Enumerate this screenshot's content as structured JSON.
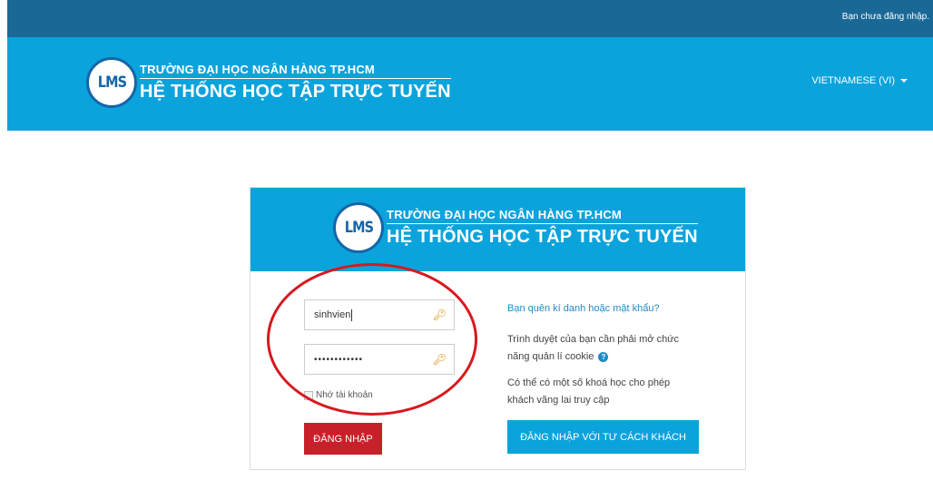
{
  "topbar": {
    "login_status": "Bạn chưa đăng nhập."
  },
  "header": {
    "logo_badge": "LMS",
    "logo_line1": "TRƯỜNG ĐẠI HỌC NGÂN HÀNG TP.HCM",
    "logo_line2": "HỆ THỐNG HỌC TẬP TRỰC TUYẾN",
    "language": "VIETNAMESE (VI)"
  },
  "login": {
    "logo_badge": "LMS",
    "logo_line1": "TRƯỜNG ĐẠI HỌC NGÂN HÀNG TP.HCM",
    "logo_line2": "HỆ THỐNG HỌC TẬP TRỰC TUYẾN",
    "username_value": "sinhvien",
    "password_value": "••••••••••••",
    "remember_label": "Nhớ tài khoản",
    "login_button": "ĐĂNG NHẬP",
    "forgot_link": "Bạn quên kí danh hoặc mật khẩu?",
    "cookie_notice": "Trình duyệt của bạn cần phải mở chức năng quản lí cookie",
    "guest_notice": "Có thể có một số khoá học cho phép khách vãng lai truy cập",
    "guest_button": "ĐĂNG NHẬP VỚI TƯ CÁCH KHÁCH"
  },
  "icons": {
    "key": "key-icon",
    "help": "help-icon",
    "caret": "caret-down-icon"
  },
  "colors": {
    "topbar": "#1a6896",
    "header": "#0ba3dc",
    "login_button": "#c8202a",
    "annotation": "#d7191f"
  }
}
